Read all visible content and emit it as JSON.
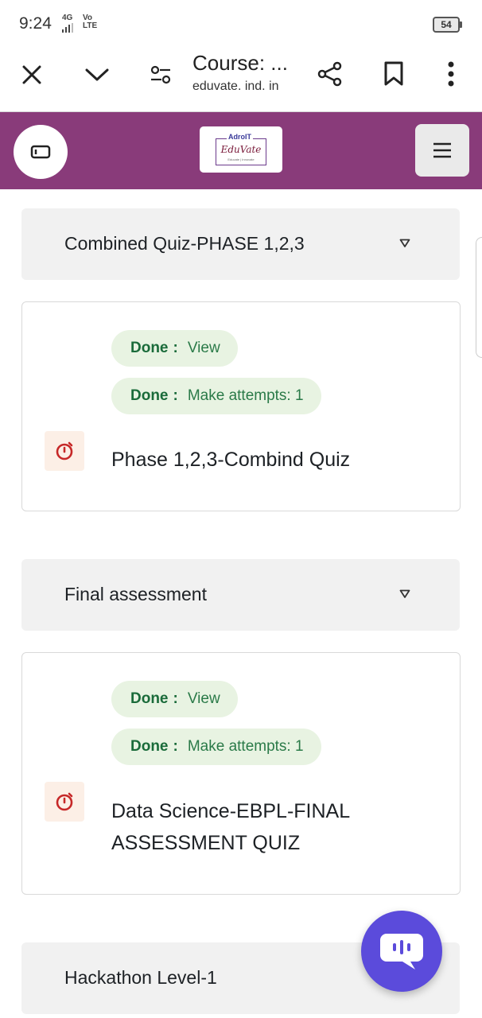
{
  "status_bar": {
    "time": "9:24",
    "network": "4G",
    "volte": "Vo LTE",
    "battery": "54"
  },
  "browser": {
    "title": "Course: ...",
    "url": "eduvate. ind. in",
    "icons": [
      "close-icon",
      "chevron-down-icon",
      "site-settings-icon",
      "share-icon",
      "bookmark-icon",
      "more-vert-icon"
    ]
  },
  "site_header": {
    "logo_top": "AdroIT",
    "logo_main": "EduVate",
    "logo_sub": "Educate | Innovate",
    "brand_color": "#893b7a"
  },
  "sections": [
    {
      "title": "Combined Quiz-PHASE 1,2,3",
      "activity": {
        "badges": [
          {
            "label": "Done",
            "text": "View"
          },
          {
            "label": "Done",
            "text": "Make attempts: 1"
          }
        ],
        "name": "Phase 1,2,3-Combind Quiz",
        "icon": "quiz-stopwatch-icon"
      }
    },
    {
      "title": "Final assessment",
      "activity": {
        "badges": [
          {
            "label": "Done",
            "text": "View"
          },
          {
            "label": "Done",
            "text": "Make attempts: 1"
          }
        ],
        "name_line1": "Data Science-EBPL-FINAL",
        "name_line2": "ASSESSMENT QUIZ",
        "icon": "quiz-stopwatch-icon"
      }
    },
    {
      "title": "Hackathon Level-1"
    }
  ],
  "chat_button": {
    "icon": "chat-bubble-icon",
    "color": "#5b4bdb"
  }
}
